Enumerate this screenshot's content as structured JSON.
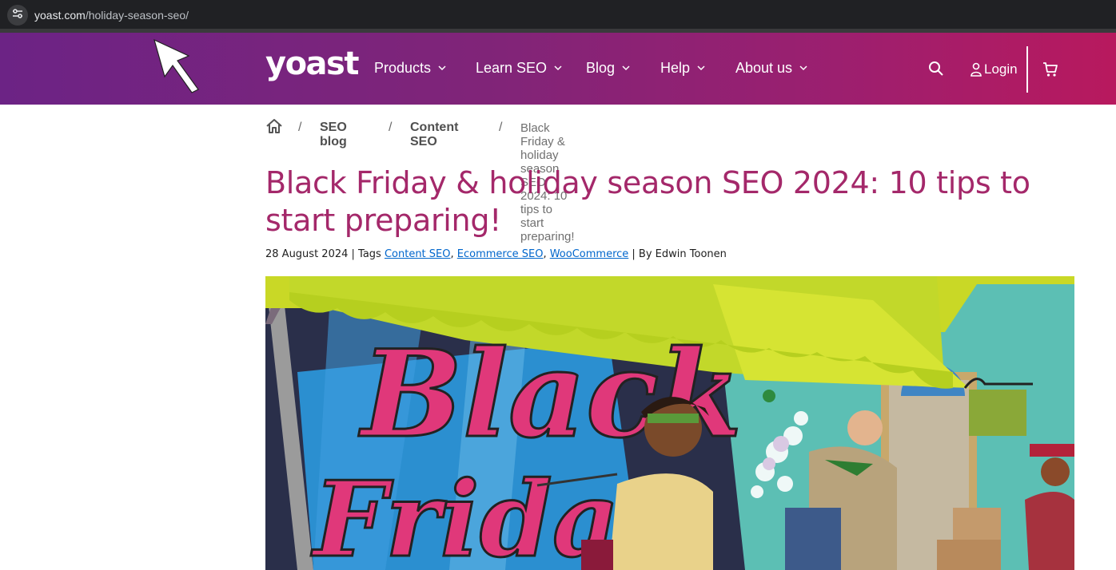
{
  "browser": {
    "url_domain": "yoast.com",
    "url_path": "/holiday-season-seo/"
  },
  "header": {
    "logo": "yoast",
    "nav": [
      {
        "label": "Products"
      },
      {
        "label": "Learn SEO"
      },
      {
        "label": "Blog"
      },
      {
        "label": "Help"
      },
      {
        "label": "About us"
      }
    ],
    "login_label": "Login"
  },
  "breadcrumb": {
    "sep": "/",
    "items": [
      {
        "label": "SEO blog"
      },
      {
        "label": "Content SEO"
      }
    ],
    "current": "Black Friday & holiday season SEO 2024: 10 tips to start preparing!"
  },
  "article": {
    "title": "Black Friday & holiday season SEO 2024: 10 tips to start preparing!",
    "date": "28 August 2024",
    "tags_prefix": " | Tags ",
    "tags": [
      "Content SEO",
      "Ecommerce SEO",
      "WooCommerce"
    ],
    "tag_sep": ", ",
    "by_prefix": " | By ",
    "author": "Edwin Toonen"
  },
  "hero": {
    "line1": "Black",
    "line2": "Friday"
  },
  "colors": {
    "header_start": "#6c2385",
    "header_end": "#b8195e",
    "title": "#a4286a",
    "link": "#0066cc"
  },
  "icons": {
    "site_info": "tune-icon",
    "home": "home-icon",
    "search": "search-icon",
    "login": "user-icon",
    "cart": "cart-icon"
  }
}
